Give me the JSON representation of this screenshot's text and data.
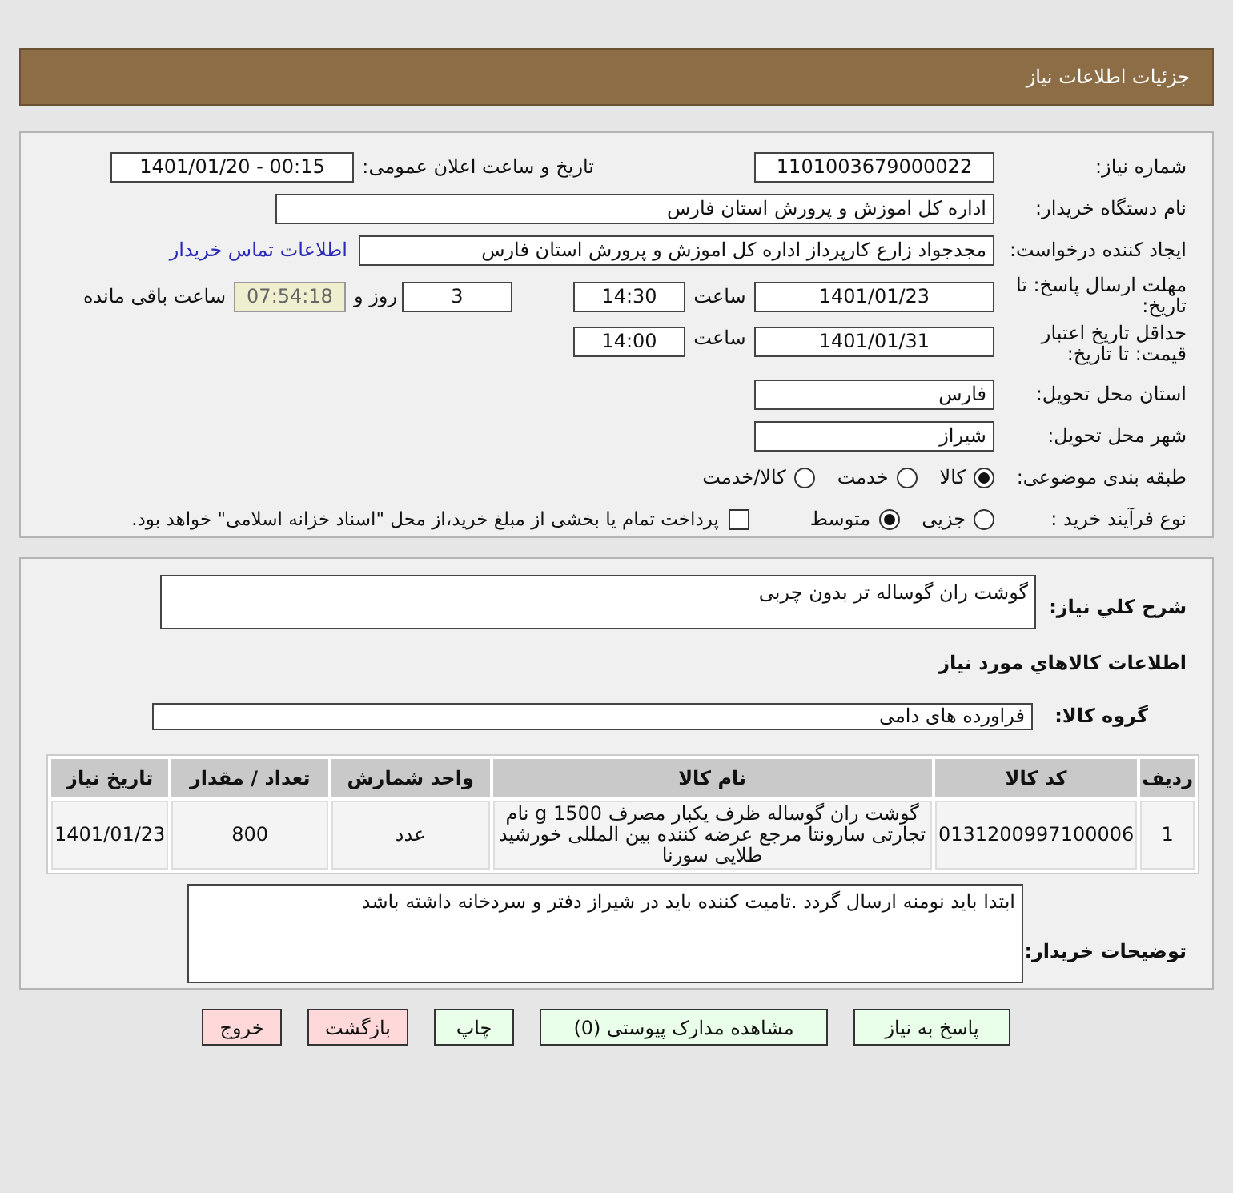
{
  "header": {
    "title": "جزئیات اطلاعات نیاز"
  },
  "rows": [
    {
      "kind": "pair",
      "label": "شماره نیاز:",
      "value": "1101003679000022",
      "label_2": "تاریخ و ساعت اعلان عمومی:",
      "value_2": "00:15 - 1401/01/20"
    },
    {
      "kind": "wide",
      "label": "نام دستگاه خریدار:",
      "value": "اداره کل اموزش و پرورش استان فارس"
    },
    {
      "kind": "link",
      "label": "ایجاد کننده درخواست:",
      "value": "مجدجواد زارع کارپرداز اداره کل اموزش و پرورش استان فارس",
      "link": "اطلاعات تماس خریدار"
    },
    {
      "kind": "deadline",
      "label": "مهلت ارسال پاسخ: تا تاریخ:",
      "date": "1401/01/23",
      "time_label": "ساعت",
      "time": "14:30",
      "days": "3",
      "days_label": "روز و",
      "remaining": "07:54:18",
      "remaining_label": "ساعت باقی مانده"
    },
    {
      "kind": "validity",
      "label": "حداقل تاریخ اعتبار قیمت: تا تاریخ:",
      "date": "1401/01/31",
      "time_label": "ساعت",
      "time": "14:00"
    },
    {
      "kind": "short",
      "label": "استان محل تحویل:",
      "value": "فارس"
    },
    {
      "kind": "short",
      "label": "شهر محل تحویل:",
      "value": "شیراز"
    },
    {
      "kind": "radios",
      "label": "طبقه بندی موضوعی:",
      "options": [
        {
          "label": "کالا",
          "selected": true
        },
        {
          "label": "خدمت",
          "selected": false
        },
        {
          "label": "کالا/خدمت",
          "selected": false
        }
      ]
    },
    {
      "kind": "process",
      "label": "نوع فرآیند خرید :",
      "options": [
        {
          "label": "جزیی",
          "selected": false
        },
        {
          "label": "متوسط",
          "selected": true
        }
      ],
      "checkbox": {
        "checked": false,
        "text": "پرداخت تمام یا بخشی از مبلغ خرید،از محل \"اسناد خزانه اسلامی\" خواهد بود."
      }
    }
  ],
  "summary": {
    "label": "شرح کلي نياز:",
    "value": "گوشت ران گوساله تر بدون چربی"
  },
  "goods_heading": "اطلاعات کالاهاي مورد نياز",
  "group": {
    "label": "گروه کالا:",
    "value": "فراورده های دامی"
  },
  "table": {
    "columns": [
      "ردیف",
      "کد کالا",
      "نام کالا",
      "واحد شمارش",
      "تعداد / مقدار",
      "تاریخ نیاز"
    ],
    "rows": [
      [
        "1",
        "0131200997100006",
        "گوشت ران گوساله ظرف یکبار مصرف 1500 g نام تجارتی سارونتا مرجع عرضه کننده بین المللی خورشید طلایی سورنا",
        "عدد",
        "800",
        "1401/01/23"
      ]
    ]
  },
  "notes": {
    "label": "توضیحات خریدار:",
    "value": "ابتدا باید نومنه ارسال گردد .تامیت کننده باید در شیراز دفتر و سردخانه داشته باشد"
  },
  "buttons": [
    {
      "label": "پاسخ به نیاز",
      "kind": "normal"
    },
    {
      "label": "مشاهده مدارک پیوستی (0)",
      "kind": "normal"
    },
    {
      "label": "چاپ",
      "kind": "normal"
    },
    {
      "label": "بازگشت",
      "kind": "warning"
    },
    {
      "label": "خروج",
      "kind": "warning"
    }
  ]
}
